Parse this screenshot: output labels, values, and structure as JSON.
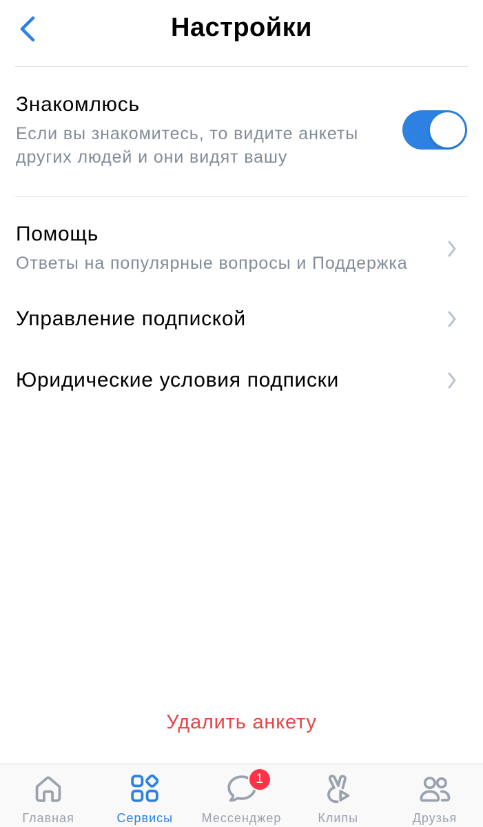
{
  "header": {
    "title": "Настройки",
    "back_icon": "chevron-left-icon"
  },
  "dating": {
    "title": "Знакомлюсь",
    "subtitle": "Если вы знакомитесь, то видите анкеты\nдругих людей и они видят вашу",
    "toggle_on": true
  },
  "menu": [
    {
      "title": "Помощь",
      "subtitle": "Ответы на популярные вопросы и Поддержка",
      "icon": "chevron-right-icon"
    },
    {
      "title": "Управление подпиской",
      "icon": "chevron-right-icon"
    },
    {
      "title": "Юридические условия подписки",
      "icon": "chevron-right-icon"
    }
  ],
  "delete_profile": {
    "label": "Удалить анкету"
  },
  "tabbar": {
    "tabs": [
      {
        "label": "Главная",
        "icon": "home-icon",
        "active": false
      },
      {
        "label": "Сервисы",
        "icon": "services-icon",
        "active": true
      },
      {
        "label": "Мессенджер",
        "icon": "messenger-icon",
        "active": false,
        "badge": "1"
      },
      {
        "label": "Клипы",
        "icon": "clips-icon",
        "active": false
      },
      {
        "label": "Друзья",
        "icon": "friends-icon",
        "active": false
      }
    ]
  },
  "colors": {
    "accent": "#2D81E0",
    "destructive": "#E64646",
    "secondary_text": "#818C99",
    "inactive": "#99A2AD",
    "chevron": "#B8C1CC",
    "divider": "#E1E3E6",
    "badge": "#FF3347",
    "tabbar_background": "#F9F9F9"
  }
}
